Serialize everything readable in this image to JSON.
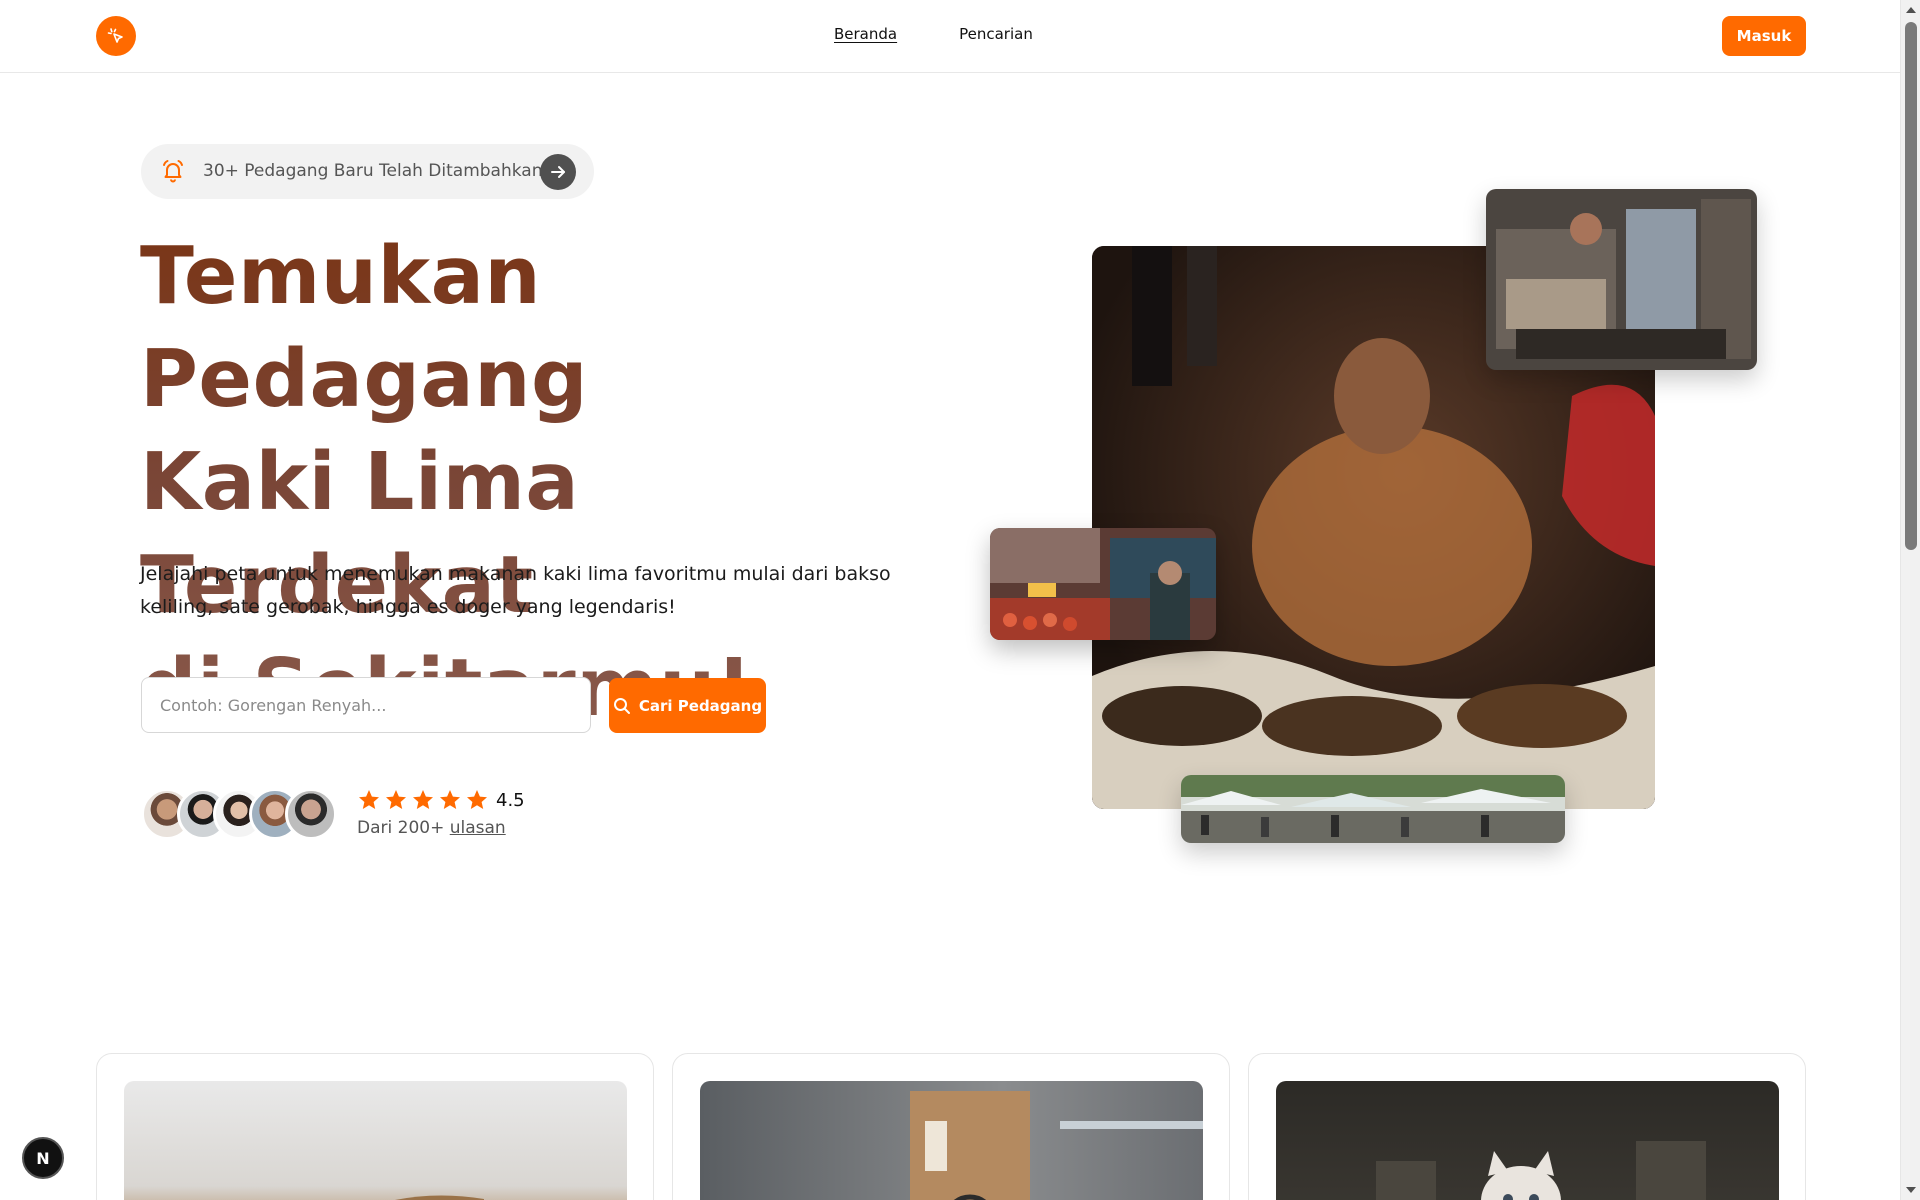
{
  "header": {
    "logo_icon": "cursor-sparkle-icon",
    "nav": [
      {
        "label": "Beranda",
        "active": true
      },
      {
        "label": "Pencarian",
        "active": false
      }
    ],
    "login_label": "Masuk"
  },
  "announcement": {
    "text": "30+ Pedagang Baru Telah Ditambahkan!",
    "icon": "bell-icon",
    "action_icon": "arrow-right-icon"
  },
  "hero": {
    "title_line1": "Temukan Pedagang",
    "title_line2": "Kaki Lima Terdekat",
    "title_line3": "di Sekitarmu!",
    "description": "Jelajahi peta untuk menemukan makanan kaki lima favoritmu mulai dari bakso keliling, sate gerobak, hingga es doger yang legendaris!"
  },
  "search": {
    "placeholder": "Contoh: Gorengan Renyah...",
    "button_label": "Cari Pedagang"
  },
  "social_proof": {
    "rating": "4.5",
    "stars": 5,
    "reviews_prefix": "Dari 200+",
    "reviews_link": "ulasan"
  },
  "colors": {
    "accent": "#ff6a00",
    "title_gradient_start": "#7a3516",
    "title_gradient_end": "#8a5a4c"
  },
  "dev_badge": "N"
}
